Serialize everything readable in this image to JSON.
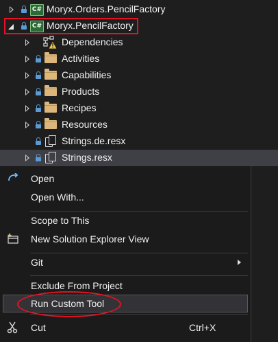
{
  "tree": {
    "items": [
      {
        "label": "Moryx.Orders.PencilFactory",
        "type": "project",
        "state": "collapsed"
      },
      {
        "label": "Moryx.PencilFactory",
        "type": "project",
        "state": "expanded"
      },
      {
        "label": "Dependencies",
        "type": "dependencies",
        "state": "collapsed"
      },
      {
        "label": "Activities",
        "type": "folder",
        "state": "collapsed"
      },
      {
        "label": "Capabilities",
        "type": "folder",
        "state": "collapsed"
      },
      {
        "label": "Products",
        "type": "folder",
        "state": "collapsed"
      },
      {
        "label": "Recipes",
        "type": "folder",
        "state": "collapsed"
      },
      {
        "label": "Resources",
        "type": "folder",
        "state": "collapsed"
      },
      {
        "label": "Strings.de.resx",
        "type": "resx",
        "state": "leaf"
      },
      {
        "label": "Strings.resx",
        "type": "resx",
        "state": "collapsed",
        "selected": true
      }
    ],
    "project_badge": "C#"
  },
  "context_menu": {
    "open": "Open",
    "open_with": "Open With...",
    "scope_to_this": "Scope to This",
    "new_solution_explorer_view": "New Solution Explorer View",
    "git": "Git",
    "exclude_from_project": "Exclude From Project",
    "run_custom_tool": "Run Custom Tool",
    "cut": "Cut",
    "cut_shortcut": "Ctrl+X"
  },
  "colors": {
    "background": "#1e1e1e",
    "selection": "#3f3f46",
    "annotation_red": "#e81123",
    "lock_blue": "#5b9bd5",
    "folder": "#dcb67a"
  }
}
